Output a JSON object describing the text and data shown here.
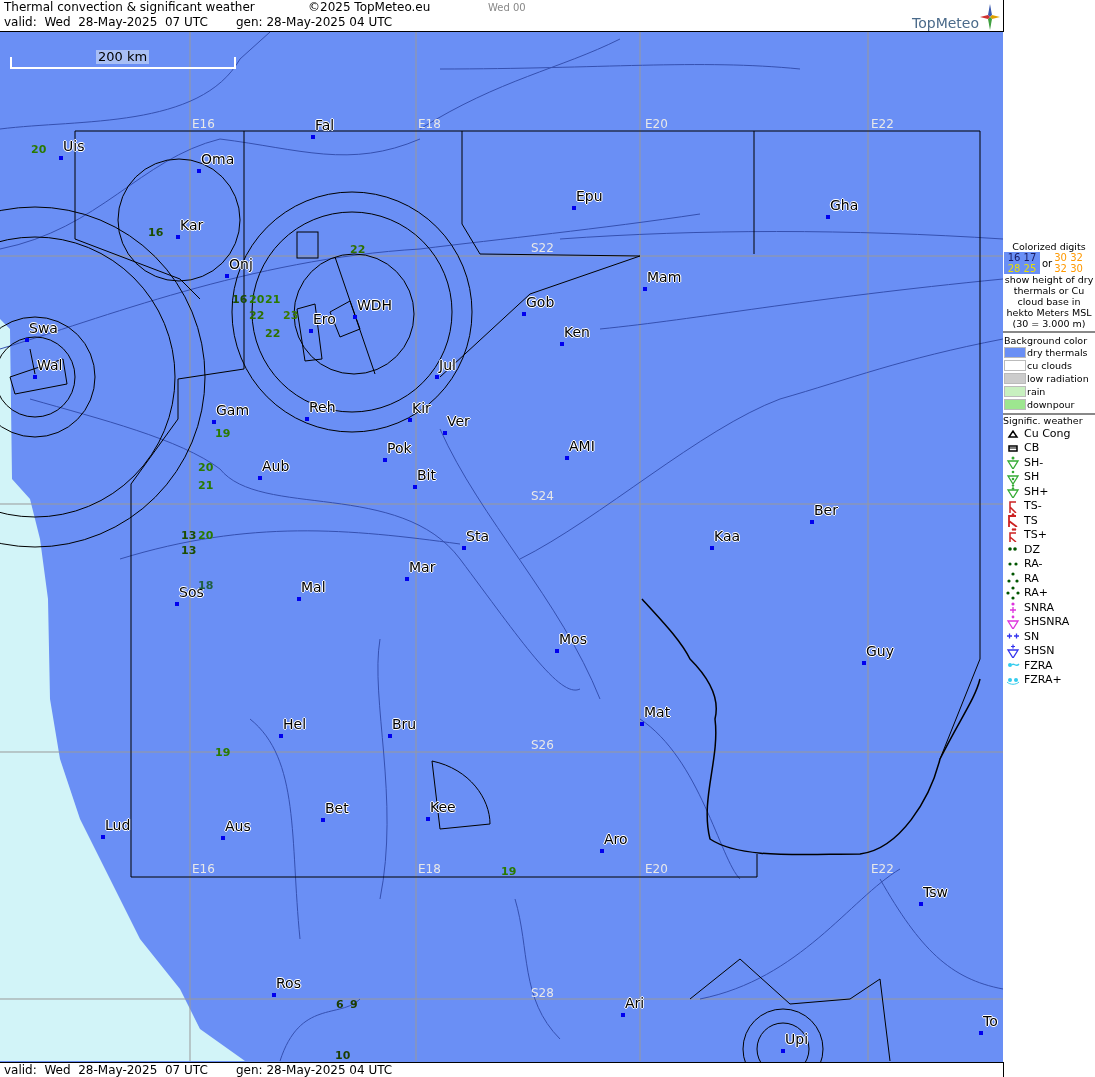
{
  "header": {
    "title": "Thermal convection & significant weather",
    "copyright": "©2025 TopMeteo.eu",
    "run_label": "Wed 00",
    "valid": "valid:  Wed  28-May-2025  07 UTC",
    "generated": "gen: 28-May-2025 04 UTC",
    "logo_text": "TopMeteo"
  },
  "scale_bar": {
    "label": "200 km"
  },
  "grid_labels": [
    "E16",
    "E18",
    "E20",
    "E22",
    "S22",
    "S24",
    "S26",
    "S28",
    "E16",
    "E18",
    "E20",
    "E22"
  ],
  "towns": [
    {
      "name": "Uis"
    },
    {
      "name": "Oma"
    },
    {
      "name": "Kar"
    },
    {
      "name": "Fal"
    },
    {
      "name": "Epu"
    },
    {
      "name": "Gha"
    },
    {
      "name": "Onj"
    },
    {
      "name": "Swa"
    },
    {
      "name": "Wal"
    },
    {
      "name": "Gob"
    },
    {
      "name": "Mam"
    },
    {
      "name": "Ken"
    },
    {
      "name": "Ero"
    },
    {
      "name": "WDH"
    },
    {
      "name": "Jul"
    },
    {
      "name": "Gam"
    },
    {
      "name": "Reh"
    },
    {
      "name": "Kir"
    },
    {
      "name": "Ver"
    },
    {
      "name": "AMI"
    },
    {
      "name": "Pok"
    },
    {
      "name": "Bit"
    },
    {
      "name": "Aub"
    },
    {
      "name": "Ber"
    },
    {
      "name": "Sta"
    },
    {
      "name": "Kaa"
    },
    {
      "name": "Mar"
    },
    {
      "name": "Mal"
    },
    {
      "name": "Sos"
    },
    {
      "name": "Mos"
    },
    {
      "name": "Guy"
    },
    {
      "name": "Mat"
    },
    {
      "name": "Hel"
    },
    {
      "name": "Bru"
    },
    {
      "name": "Lud"
    },
    {
      "name": "Aus"
    },
    {
      "name": "Bet"
    },
    {
      "name": "Kee"
    },
    {
      "name": "Aro"
    },
    {
      "name": "Tsw"
    },
    {
      "name": "Ros"
    },
    {
      "name": "Ari"
    },
    {
      "name": "To"
    },
    {
      "name": "Upi"
    }
  ],
  "thermal_digits": [
    {
      "value": "20",
      "color": "#2a7a00"
    },
    {
      "value": "16",
      "color": "#1c4d00"
    },
    {
      "value": "22",
      "color": "#2f7000"
    },
    {
      "value": "16",
      "color": "#1c4d00"
    },
    {
      "value": "20",
      "color": "#2a7a00"
    },
    {
      "value": "21",
      "color": "#2a7a00"
    },
    {
      "value": "22",
      "color": "#2f7000"
    },
    {
      "value": "23",
      "color": "#3a7a00"
    },
    {
      "value": "22",
      "color": "#2f7000"
    },
    {
      "value": "19",
      "color": "#2a7a00"
    },
    {
      "value": "20",
      "color": "#2a7a00"
    },
    {
      "value": "21",
      "color": "#2a7a00"
    },
    {
      "value": "13",
      "color": "#1c4d00"
    },
    {
      "value": "20",
      "color": "#2a7a00"
    },
    {
      "value": "13",
      "color": "#1c4d00"
    },
    {
      "value": "18",
      "color": "#1f5f40"
    },
    {
      "value": "19",
      "color": "#2a7a00"
    },
    {
      "value": "19",
      "color": "#2a7a00"
    },
    {
      "value": "6",
      "color": "#1c3d00"
    },
    {
      "value": "9",
      "color": "#1c3d00"
    },
    {
      "value": "10",
      "color": "#1c3d00"
    }
  ],
  "legend": {
    "digits_title": "Colorized digits",
    "digit_samples": [
      {
        "text": "16 17"
      },
      {
        "text": "28 25"
      },
      {
        "text": "30 32"
      },
      {
        "text": "32 30"
      }
    ],
    "or_label": "or",
    "digits_text": "show height of dry thermals or Cu cloud base in hekto Meters MSL (30 = 3.000 m)",
    "background_title": "Background color",
    "background_items": [
      {
        "label": "dry thermals",
        "color": "#6a8ff5"
      },
      {
        "label": "cu clouds",
        "color": "#ffffff"
      },
      {
        "label": "low radiation",
        "color": "#cccccc"
      },
      {
        "label": "rain",
        "color": "#c8f0c0"
      },
      {
        "label": "downpour",
        "color": "#9de68f"
      }
    ],
    "weather_title": "Signific. weather",
    "weather_items": [
      {
        "label": "Cu Cong",
        "kind": "cucong"
      },
      {
        "label": "CB",
        "kind": "cb"
      },
      {
        "label": "SH-",
        "kind": "shlight"
      },
      {
        "label": "SH",
        "kind": "sh"
      },
      {
        "label": "SH+",
        "kind": "shheavy"
      },
      {
        "label": "TS-",
        "kind": "tslight"
      },
      {
        "label": "TS",
        "kind": "ts"
      },
      {
        "label": "TS+",
        "kind": "tsheavy"
      },
      {
        "label": "DZ",
        "kind": "dz"
      },
      {
        "label": "RA-",
        "kind": "ralight"
      },
      {
        "label": "RA",
        "kind": "ra"
      },
      {
        "label": "RA+",
        "kind": "raheavy"
      },
      {
        "label": "SNRA",
        "kind": "snra"
      },
      {
        "label": "SHSNRA",
        "kind": "shsnra"
      },
      {
        "label": "SN",
        "kind": "sn"
      },
      {
        "label": "SHSN",
        "kind": "shsn"
      },
      {
        "label": "FZRA",
        "kind": "fzra"
      },
      {
        "label": "FZRA+",
        "kind": "fzraheavy"
      }
    ]
  },
  "footer": {
    "valid": "valid:  Wed  28-May-2025  07 UTC",
    "generated": "gen: 28-May-2025 04 UTC"
  }
}
